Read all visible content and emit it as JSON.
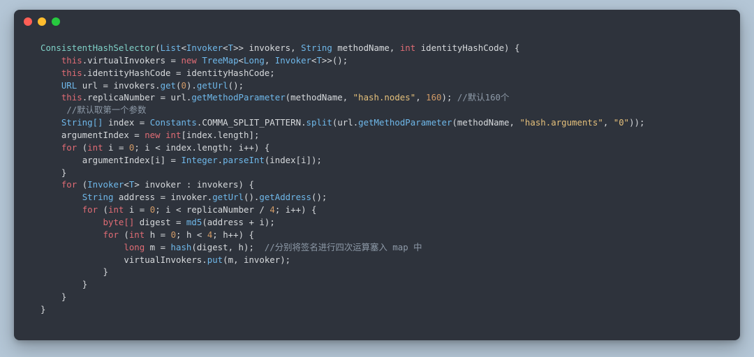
{
  "window": {
    "buttons": [
      "close",
      "minimize",
      "zoom"
    ]
  },
  "code": {
    "ctor": "ConsistentHashSelector",
    "param_list_ty": "List",
    "param_invoker_ty": "Invoker",
    "generic_t": "T",
    "param_invokers": "invokers",
    "param_string_ty": "String",
    "param_methodname": "methodName",
    "param_int": "int",
    "param_identity": "identityHashCode",
    "this": "this",
    "field_virtualInvokers": "virtualInvokers",
    "new": "new",
    "treemap_ty": "TreeMap",
    "long_ty": "Long",
    "field_identityHashCode": "identityHashCode",
    "url_ty": "URL",
    "var_url": "url",
    "get": "get",
    "getUrl": "getUrl",
    "field_replicaNumber": "replicaNumber",
    "getMethodParameter": "getMethodParameter",
    "str_hash_nodes": "\"hash.nodes\"",
    "num_160": "160",
    "comment_160": "//默认160个",
    "comment_first_arg": "//默认取第一个参数",
    "string_arr": "String[]",
    "var_index": "index",
    "constants": "Constants",
    "comma_pattern": "COMMA_SPLIT_PATTERN",
    "split": "split",
    "str_hash_arguments": "\"hash.arguments\"",
    "str_zero": "\"0\"",
    "argumentIndex": "argumentIndex",
    "int_arr": "int",
    "length": "length",
    "for": "for",
    "var_i": "i",
    "integer_ty": "Integer",
    "parseInt": "parseInt",
    "invoker_var": "invoker",
    "var_address": "address",
    "getAddress": "getAddress",
    "num_4": "4",
    "byte_arr": "byte[]",
    "var_digest": "digest",
    "md5": "md5",
    "var_h": "h",
    "long_kw": "long",
    "var_m": "m",
    "hash": "hash",
    "comment_hash": "//分别将签名进行四次运算塞入 map 中",
    "put": "put",
    "num_0": "0"
  }
}
